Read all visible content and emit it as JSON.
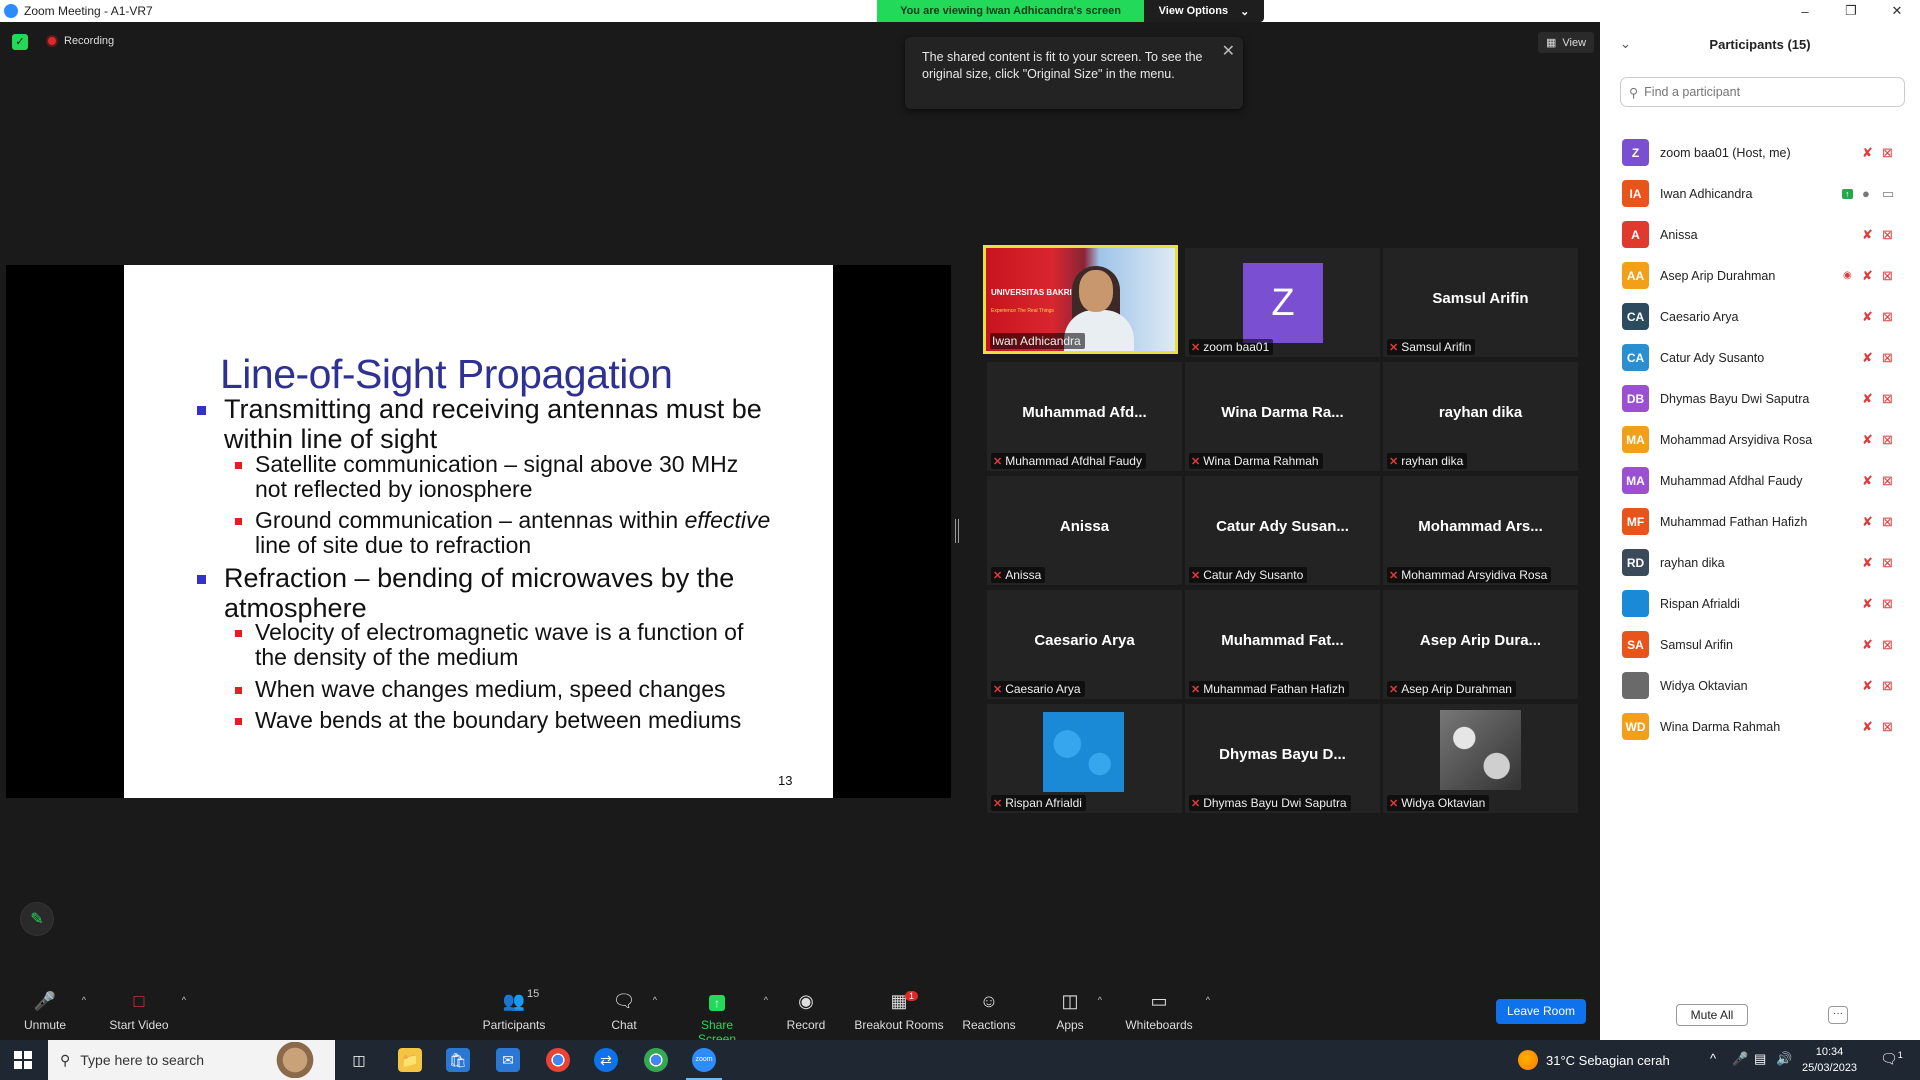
{
  "window": {
    "title": "Zoom Meeting - A1-VR7",
    "viewing_banner": "You are viewing Iwan Adhicandra's screen",
    "view_options": "View Options"
  },
  "meeting": {
    "recording_label": "Recording",
    "view_label": "View",
    "tooltip_text": "The shared content is fit to your screen. To see the original size, click \"Original Size\" in the menu."
  },
  "slide": {
    "title": "Line-of-Sight Propagation",
    "bullets": [
      {
        "level": 1,
        "text_a": "Transmitting and receiving antennas must be",
        "text_b": "within line of sight"
      },
      {
        "level": 2,
        "text_a": "Satellite communication – signal above 30 MHz",
        "text_b": "not reflected by ionosphere"
      },
      {
        "level": 2,
        "text_a": "Ground communication – antennas within ",
        "emph": "effective",
        "text_b": "line of site due to refraction"
      },
      {
        "level": 1,
        "text_a": "Refraction – bending of microwaves by the",
        "text_b": "atmosphere"
      },
      {
        "level": 2,
        "text_a": "Velocity of electromagnetic wave is a function of",
        "text_b": "the density of the medium"
      },
      {
        "level": 2,
        "text_a": "When wave changes medium, speed changes"
      },
      {
        "level": 2,
        "text_a": "Wave bends at the boundary between mediums"
      }
    ],
    "page_number": "13"
  },
  "gallery": [
    {
      "display": "",
      "label": "Iwan Adhicandra",
      "kind": "video",
      "uni_text": "UNIVERSITAS BAKRIE",
      "tagline": "Experience The Real Things"
    },
    {
      "display": "Z",
      "label": "zoom baa01",
      "kind": "letter"
    },
    {
      "display": "Samsul Arifin",
      "label": "Samsul Arifin",
      "kind": "name"
    },
    {
      "display": "Muhammad  Afd...",
      "label": "Muhammad Afdhal Faudy",
      "kind": "name"
    },
    {
      "display": "Wina  Darma  Ra...",
      "label": "Wina Darma Rahmah",
      "kind": "name"
    },
    {
      "display": "rayhan dika",
      "label": "rayhan dika",
      "kind": "name"
    },
    {
      "display": "Anissa",
      "label": "Anissa",
      "kind": "name"
    },
    {
      "display": "Catur  Ady  Susan...",
      "label": "Catur Ady Susanto",
      "kind": "name"
    },
    {
      "display": "Mohammad  Ars...",
      "label": "Mohammad Arsyidiva Rosa",
      "kind": "name"
    },
    {
      "display": "Caesario Arya",
      "label": "Caesario Arya",
      "kind": "name"
    },
    {
      "display": "Muhammad  Fat...",
      "label": "Muhammad Fathan Hafizh",
      "kind": "name"
    },
    {
      "display": "Asep  Arip  Dura...",
      "label": "Asep Arip Durahman",
      "kind": "name"
    },
    {
      "display": "",
      "label": "Rispan Afrialdi",
      "kind": "blue"
    },
    {
      "display": "Dhymas  Bayu  D...",
      "label": "Dhymas Bayu Dwi Saputra",
      "kind": "name"
    },
    {
      "display": "",
      "label": "Widya Oktavian",
      "kind": "photo"
    }
  ],
  "toolbar": {
    "unmute": "Unmute",
    "start_video": "Start Video",
    "participants": "Participants",
    "participants_count": "15",
    "chat": "Chat",
    "share_screen": "Share Screen",
    "record": "Record",
    "breakout_rooms": "Breakout Rooms",
    "breakout_badge": "1",
    "reactions": "Reactions",
    "apps": "Apps",
    "whiteboards": "Whiteboards",
    "leave_room": "Leave Room"
  },
  "panel": {
    "title": "Participants (15)",
    "search_placeholder": "Find a participant",
    "participants": [
      {
        "initials": "Z",
        "name": "zoom baa01 (Host, me)",
        "color": "#7a4fd1",
        "mic": "muted",
        "video": "off",
        "extra": ""
      },
      {
        "initials": "IA",
        "name": "Iwan Adhicandra",
        "color": "#e8541a",
        "mic": "on",
        "video": "on",
        "extra": "share"
      },
      {
        "initials": "A",
        "name": "Anissa",
        "color": "#e03a2f",
        "mic": "muted",
        "video": "off",
        "extra": ""
      },
      {
        "initials": "AA",
        "name": "Asep Arip Durahman",
        "color": "#f2a01a",
        "mic": "muted",
        "video": "off",
        "extra": "record"
      },
      {
        "initials": "CA",
        "name": "Caesario Arya",
        "color": "#2e4a5e",
        "mic": "muted",
        "video": "off",
        "extra": ""
      },
      {
        "initials": "CA",
        "name": "Catur Ady Susanto",
        "color": "#2a8fd1",
        "mic": "muted",
        "video": "off",
        "extra": ""
      },
      {
        "initials": "DB",
        "name": "Dhymas Bayu Dwi Saputra",
        "color": "#9b4fd1",
        "mic": "muted",
        "video": "off",
        "extra": ""
      },
      {
        "initials": "MA",
        "name": "Mohammad Arsyidiva Rosa",
        "color": "#f2a01a",
        "mic": "muted",
        "video": "off",
        "extra": ""
      },
      {
        "initials": "MA",
        "name": "Muhammad Afdhal Faudy",
        "color": "#9b4fd1",
        "mic": "muted",
        "video": "off",
        "extra": ""
      },
      {
        "initials": "MF",
        "name": "Muhammad Fathan Hafizh",
        "color": "#e8541a",
        "mic": "muted",
        "video": "off",
        "extra": ""
      },
      {
        "initials": "RD",
        "name": "rayhan dika",
        "color": "#3a4a5a",
        "mic": "muted",
        "video": "off",
        "extra": ""
      },
      {
        "initials": "",
        "name": "Rispan Afrialdi",
        "color": "#1a8ad6",
        "mic": "muted",
        "video": "off",
        "extra": ""
      },
      {
        "initials": "SA",
        "name": "Samsul Arifin",
        "color": "#e8541a",
        "mic": "muted",
        "video": "off",
        "extra": ""
      },
      {
        "initials": "",
        "name": "Widya Oktavian",
        "color": "#6a6a6a",
        "mic": "muted",
        "video": "off",
        "extra": ""
      },
      {
        "initials": "WD",
        "name": "Wina Darma Rahmah",
        "color": "#f2a01a",
        "mic": "muted",
        "video": "off",
        "extra": ""
      }
    ],
    "mute_all": "Mute All",
    "more": "···"
  },
  "taskbar": {
    "search_placeholder": "Type here to search",
    "weather": "31°C  Sebagian cerah",
    "time": "10:34",
    "date": "25/03/2023",
    "notif_count": "1"
  }
}
